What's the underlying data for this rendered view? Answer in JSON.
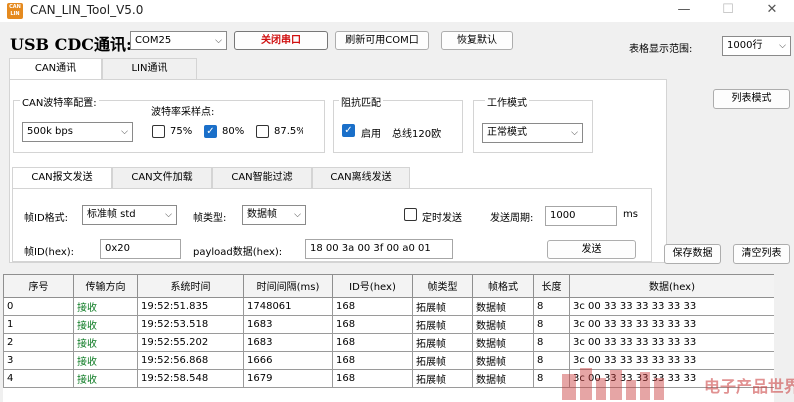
{
  "window": {
    "title": "CAN_LIN_Tool_V5.0",
    "icon_text": "CAN LIN"
  },
  "header": {
    "device_label": "USB CDC通讯:",
    "port_value": "COM25",
    "close_port": "关闭串口",
    "refresh_com": "刷新可用COM口",
    "restore_default": "恢复默认",
    "range_label": "表格显示范围:",
    "range_value": "1000行"
  },
  "main_tabs": [
    "CAN通讯",
    "LIN通讯"
  ],
  "baud": {
    "group_title": "CAN波特率配置:",
    "baud_value": "500k bps",
    "sample_title": "波特率采样点:",
    "sample_points": [
      {
        "label": "75%",
        "checked": false
      },
      {
        "label": "80%",
        "checked": true
      },
      {
        "label": "87.5%",
        "checked": false
      }
    ]
  },
  "impedance": {
    "title": "阻抗匹配",
    "enable_label": "启用",
    "bus_label": "总线120欧"
  },
  "work_mode": {
    "title": "工作模式",
    "value": "正常模式"
  },
  "list_mode_button": "列表模式",
  "sub_tabs": [
    "CAN报文发送",
    "CAN文件加载",
    "CAN智能过滤",
    "CAN离线发送"
  ],
  "send": {
    "id_format_label": "帧ID格式:",
    "id_format_value": "标准帧 std",
    "frame_type_label": "帧类型:",
    "frame_type_value": "数据帧",
    "timed_send_label": "定时发送",
    "period_label": "发送周期:",
    "period_value": "1000",
    "period_unit": "ms",
    "frame_id_label": "帧ID(hex):",
    "frame_id_value": "0x20",
    "payload_label": "payload数据(hex):",
    "payload_value": "18 00 3a 00 3f 00 a0 01",
    "send_button": "发送",
    "save_button": "保存数据",
    "clear_button": "清空列表"
  },
  "table": {
    "columns": [
      "序号",
      "传输方向",
      "系统时间",
      "时间间隔(ms)",
      "ID号(hex)",
      "帧类型",
      "帧格式",
      "长度",
      "数据(hex)"
    ],
    "rows": [
      [
        "0",
        "接收",
        "19:52:51.835",
        "1748061",
        "168",
        "拓展帧",
        "数据帧",
        "8",
        "3c 00 33 33 33 33 33 33"
      ],
      [
        "1",
        "接收",
        "19:52:53.518",
        "1683",
        "168",
        "拓展帧",
        "数据帧",
        "8",
        "3c 00 33 33 33 33 33 33"
      ],
      [
        "2",
        "接收",
        "19:52:55.202",
        "1683",
        "168",
        "拓展帧",
        "数据帧",
        "8",
        "3c 00 33 33 33 33 33 33"
      ],
      [
        "3",
        "接收",
        "19:52:56.868",
        "1666",
        "168",
        "拓展帧",
        "数据帧",
        "8",
        "3c 00 33 33 33 33 33 33"
      ],
      [
        "4",
        "接收",
        "19:52:58.548",
        "1679",
        "168",
        "拓展帧",
        "数据帧",
        "8",
        "3c 00 33 33 33 33 33 33"
      ]
    ]
  },
  "watermark": {
    "text": "电子产品世界"
  },
  "colors": {
    "direction_text": "#0b7a22",
    "close_port_text": "#d01010",
    "checkbox_accent": "#1a6fc9",
    "watermark": "#c93a3a"
  }
}
